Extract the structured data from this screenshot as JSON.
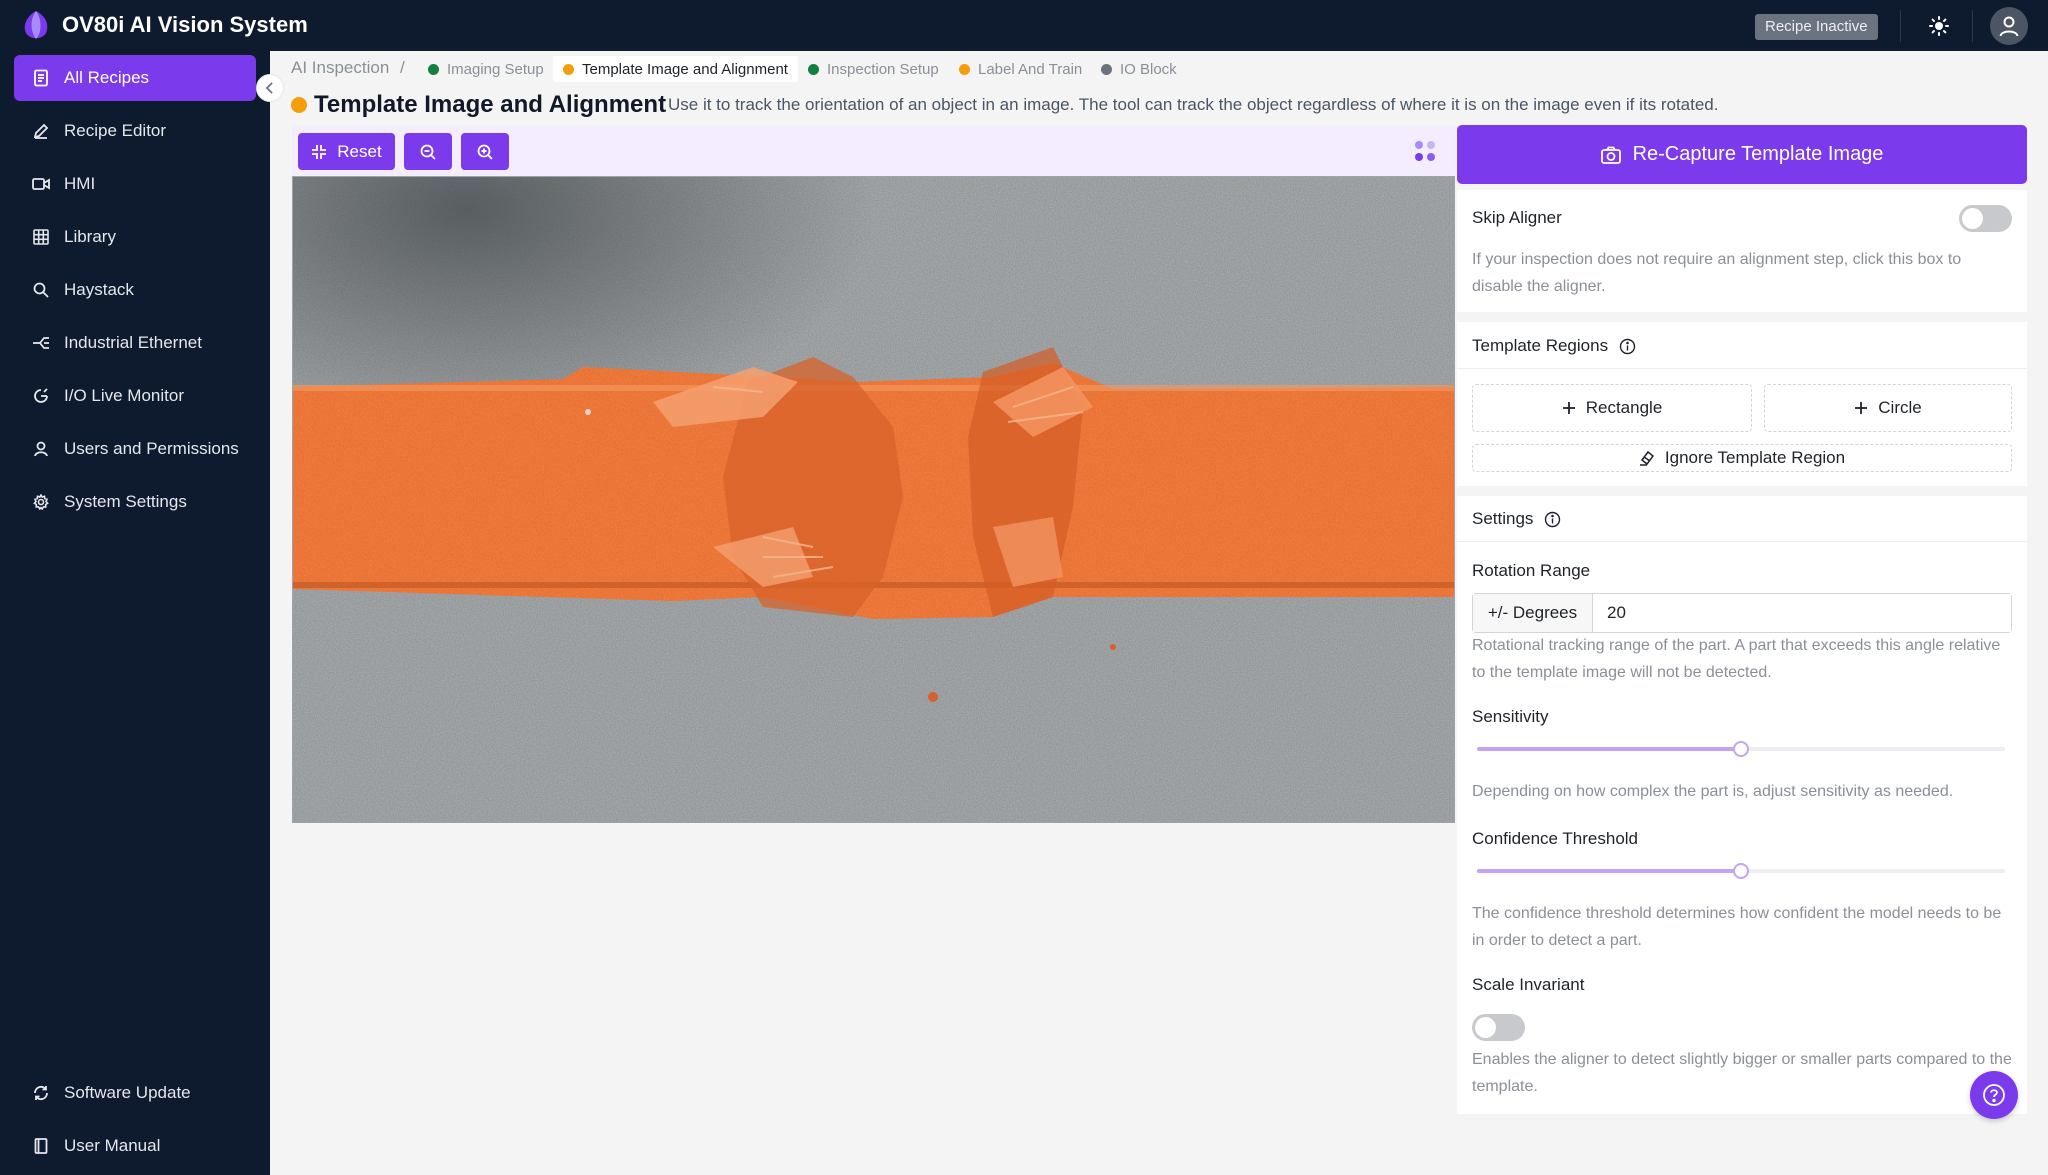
{
  "app": {
    "title": "OV80i AI Vision System",
    "recipe_status": "Recipe Inactive",
    "brand_color": "#7c3aed"
  },
  "sidebar": {
    "items": [
      {
        "label": "All Recipes",
        "icon": "document-icon",
        "active": true
      },
      {
        "label": "Recipe Editor",
        "icon": "pencil-icon"
      },
      {
        "label": "HMI",
        "icon": "video-icon"
      },
      {
        "label": "Library",
        "icon": "grid-icon"
      },
      {
        "label": "Haystack",
        "icon": "search-icon"
      },
      {
        "label": "Industrial Ethernet",
        "icon": "ethernet-icon"
      },
      {
        "label": "I/O Live Monitor",
        "icon": "monitor-icon"
      },
      {
        "label": "Users and Permissions",
        "icon": "user-icon"
      },
      {
        "label": "System Settings",
        "icon": "gear-icon"
      }
    ],
    "bottom": [
      {
        "label": "Software Update",
        "icon": "refresh-icon"
      },
      {
        "label": "User Manual",
        "icon": "book-icon"
      }
    ]
  },
  "breadcrumb": {
    "root": "AI Inspection",
    "separator": "/",
    "steps": [
      {
        "label": "Imaging Setup",
        "status_color": "#15803d"
      },
      {
        "label": "Template Image and Alignment",
        "status_color": "#f59e0b",
        "active": true
      },
      {
        "label": "Inspection Setup",
        "status_color": "#15803d"
      },
      {
        "label": "Label And Train",
        "status_color": "#f59e0b"
      },
      {
        "label": "IO Block",
        "status_color": "#6b7280"
      }
    ]
  },
  "page": {
    "title": "Template Image and Alignment",
    "status_color": "#f59e0b",
    "description": "Use it to track the orientation of an object in an image. The tool can track the object regardless of where it is on the image even if its rotated."
  },
  "toolbar": {
    "reset_label": "Reset",
    "zoom_out_icon": "zoom-out-icon",
    "zoom_in_icon": "zoom-in-icon"
  },
  "panel": {
    "recapture_label": "Re-Capture Template Image",
    "skip_aligner": {
      "label": "Skip Aligner",
      "enabled": false,
      "help": "If your inspection does not require an alignment step, click this box to disable the aligner."
    },
    "template_regions": {
      "title": "Template Regions",
      "rectangle_label": "Rectangle",
      "circle_label": "Circle",
      "ignore_label": "Ignore Template Region"
    },
    "settings": {
      "title": "Settings",
      "rotation": {
        "label": "Rotation Range",
        "addon": "+/- Degrees",
        "value": "20",
        "help": "Rotational tracking range of the part. A part that exceeds this angle relative to the template image will not be detected."
      },
      "sensitivity": {
        "label": "Sensitivity",
        "level": 0.5,
        "help": "Depending on how complex the part is, adjust sensitivity as needed."
      },
      "confidence": {
        "label": "Confidence Threshold",
        "level": 0.5,
        "help": "The confidence threshold determines how confident the model needs to be in order to detect a part."
      },
      "scale_invariant": {
        "label": "Scale Invariant",
        "enabled": false,
        "help": "Enables the aligner to detect slightly bigger or smaller parts compared to the template."
      }
    }
  }
}
